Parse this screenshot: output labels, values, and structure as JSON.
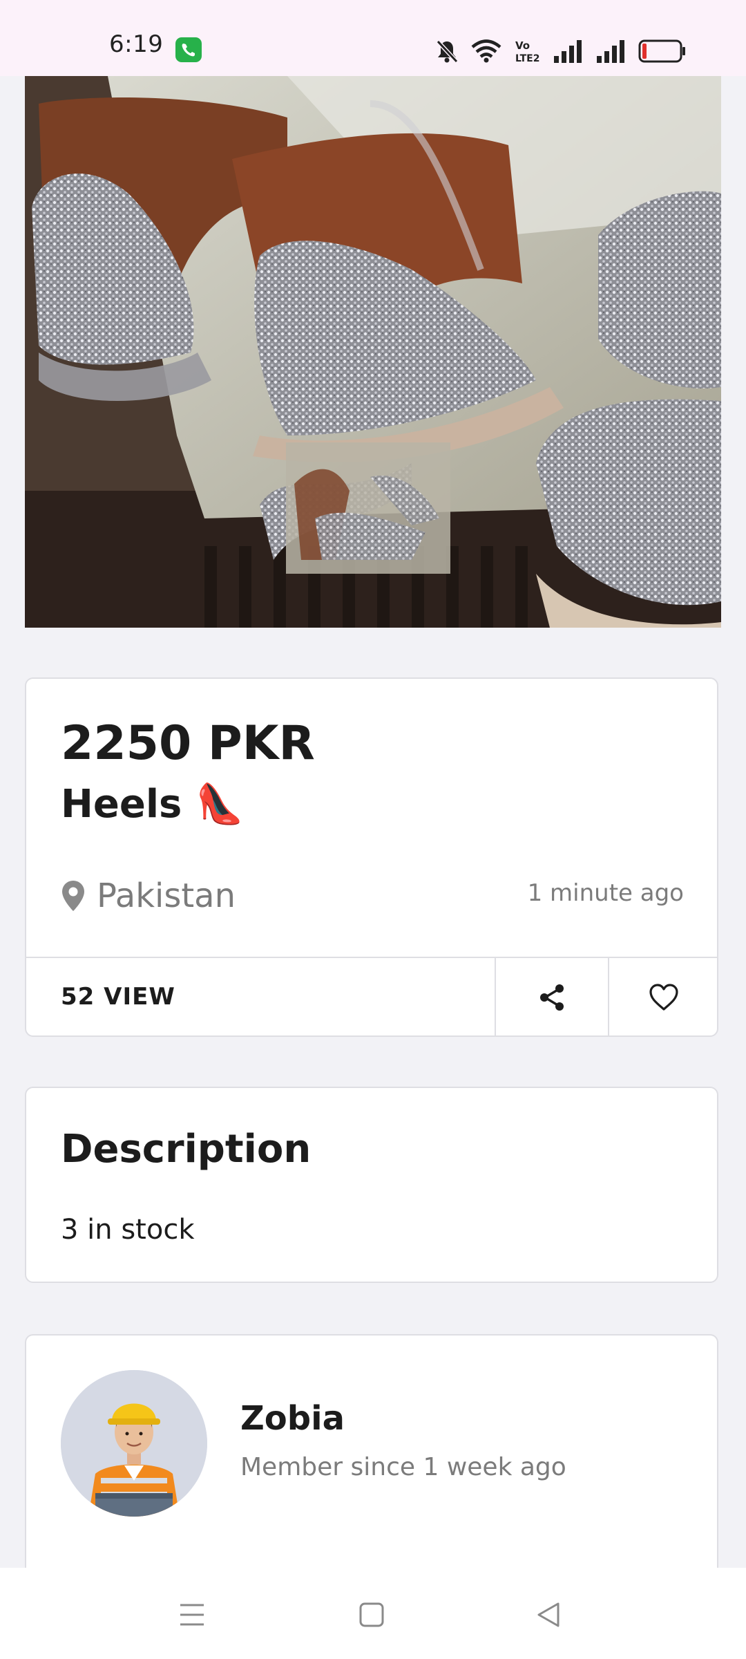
{
  "status_bar": {
    "time": "6:19",
    "icons": [
      "call-icon",
      "mute-icon",
      "wifi-icon",
      "volte-icon",
      "signal-icon",
      "signal-icon",
      "battery-icon"
    ]
  },
  "listing": {
    "price": "2250 PKR",
    "title": "Heels",
    "title_emoji": "👠",
    "location": "Pakistan",
    "posted": "1 minute ago",
    "views": "52 VIEW"
  },
  "description": {
    "heading": "Description",
    "text": "3 in stock"
  },
  "seller": {
    "name": "Zobia",
    "member_since": "Member since 1 week ago"
  },
  "colors": {
    "status_bg": "#fcf2fa",
    "page_bg": "#f2f2f6",
    "card_border": "#dedee3",
    "muted_text": "#7b7b7b",
    "call_green": "#27b14a"
  }
}
